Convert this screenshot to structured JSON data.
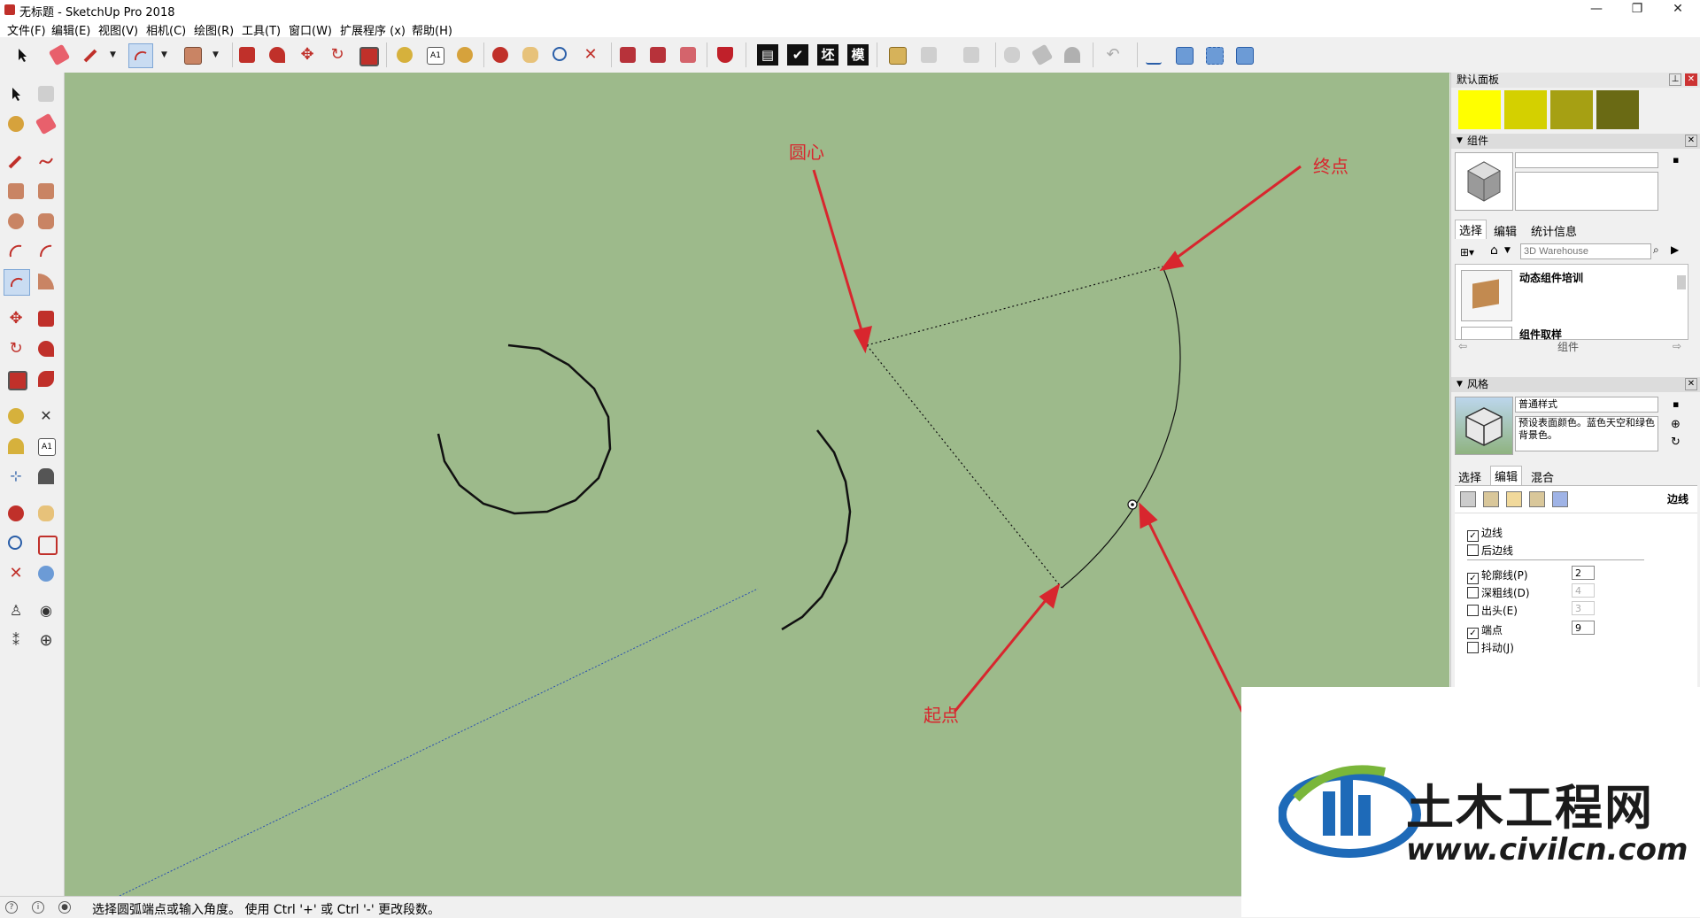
{
  "window": {
    "title": "无标题 - SketchUp Pro 2018",
    "controls": [
      "—",
      "❐",
      "✕"
    ]
  },
  "menu": [
    "文件(F)",
    "编辑(E)",
    "视图(V)",
    "相机(C)",
    "绘图(R)",
    "工具(T)",
    "窗口(W)",
    "扩展程序 (x)",
    "帮助(H)"
  ],
  "toolbar": {
    "text_buttons": [
      "▤",
      "✔",
      "坯",
      "模"
    ]
  },
  "annotations": {
    "center": "圆心",
    "end": "终点",
    "start": "起点"
  },
  "tray": {
    "default_tray": "默认面板",
    "swatches": [
      "#ffff00",
      "#d4d000",
      "#a6a013",
      "#6a6a14"
    ],
    "components": {
      "title": "组件",
      "tabs": [
        "选择",
        "编辑",
        "统计信息"
      ],
      "search_placeholder": "3D Warehouse",
      "items": [
        "动态组件培训",
        "组件取样"
      ],
      "nav_label": "组件"
    },
    "styles": {
      "title": "风格",
      "style_name": "普通样式",
      "style_desc": "预设表面颜色。蓝色天空和绿色背景色。",
      "tabs": [
        "选择",
        "编辑",
        "混合"
      ],
      "section": "边线",
      "options": [
        {
          "label": "边线",
          "checked": true,
          "value": ""
        },
        {
          "label": "后边线",
          "checked": false,
          "value": ""
        },
        {
          "label": "轮廓线(P)",
          "checked": true,
          "value": "2"
        },
        {
          "label": "深粗线(D)",
          "checked": false,
          "value": "4"
        },
        {
          "label": "出头(E)",
          "checked": false,
          "value": "3"
        },
        {
          "label": "端点",
          "checked": true,
          "value": "9"
        },
        {
          "label": "抖动(J)",
          "checked": false,
          "value": ""
        }
      ]
    }
  },
  "status": {
    "message": "选择圆弧端点或输入角度。 使用 Ctrl '+' 或 Ctrl '-' 更改段数。"
  },
  "watermark": {
    "title": "土木工程网",
    "url": "www.civilcn.com"
  }
}
